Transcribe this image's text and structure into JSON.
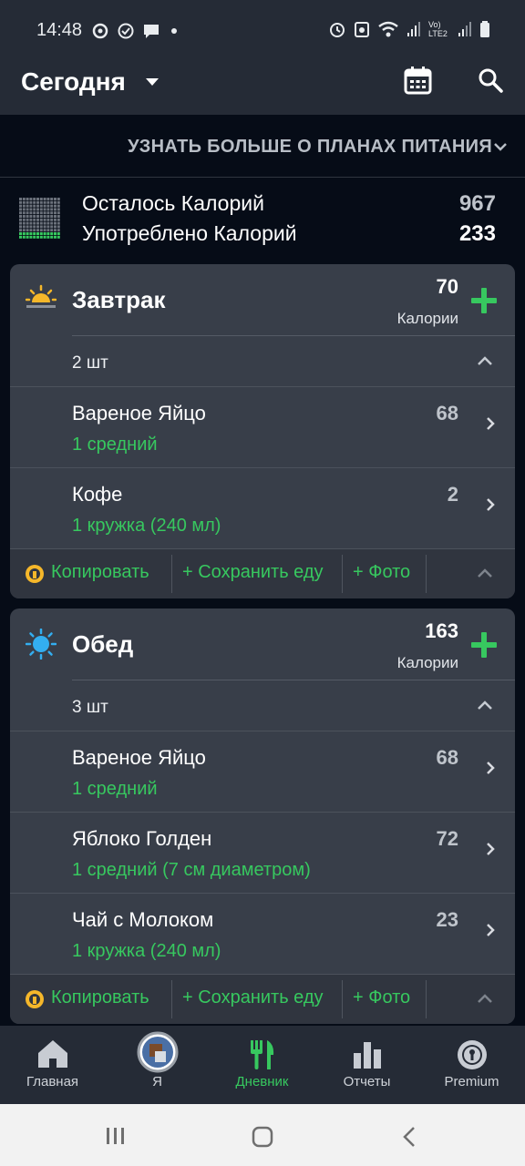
{
  "status_bar": {
    "time": "14:48",
    "icons": [
      "sync-icon",
      "check-circle-icon",
      "chat-icon",
      "dot-icon",
      "alarm-icon",
      "recycle-icon",
      "wifi-icon",
      "signal-icon",
      "volte-icon",
      "battery-icon"
    ],
    "network_label": "Vo) LTE2"
  },
  "header": {
    "title": "Сегодня",
    "icons": [
      "caret-down-icon",
      "calendar-icon",
      "search-icon"
    ]
  },
  "plans_banner": {
    "label": "УЗНАТЬ БОЛЬШЕ О ПЛАНАХ ПИТАНИЯ"
  },
  "summary": {
    "remaining_label": "Осталось Калорий",
    "remaining_value": "967",
    "consumed_label": "Употреблено Калорий",
    "consumed_value": "233"
  },
  "meals": [
    {
      "name": "Завтрак",
      "icon": "sunrise-icon",
      "calories": "70",
      "calories_label": "Калории",
      "count": "2 шт",
      "items": [
        {
          "name": "Вареное Яйцо",
          "portion": "1 средний",
          "calories": "68"
        },
        {
          "name": "Кофе",
          "portion": "1 кружка (240 мл)",
          "calories": "2"
        }
      ],
      "actions": {
        "copy": "Копировать",
        "save": "+ Сохранить еду",
        "photo": "+ Фото"
      }
    },
    {
      "name": "Обед",
      "icon": "sun-icon",
      "calories": "163",
      "calories_label": "Калории",
      "count": "3 шт",
      "items": [
        {
          "name": "Вареное Яйцо",
          "portion": "1 средний",
          "calories": "68"
        },
        {
          "name": "Яблоко Голден",
          "portion": "1 средний (7 см диаметром)",
          "calories": "72"
        },
        {
          "name": "Чай с Молоком",
          "portion": "1 кружка (240 мл)",
          "calories": "23"
        }
      ],
      "actions": {
        "copy": "Копировать",
        "save": "+ Сохранить еду",
        "photo": "+ Фото"
      }
    }
  ],
  "bottom_nav": [
    {
      "label": "Главная",
      "icon": "home-icon"
    },
    {
      "label": "Я",
      "icon": "avatar-icon"
    },
    {
      "label": "Дневник",
      "icon": "fork-knife-icon",
      "active": true
    },
    {
      "label": "Отчеты",
      "icon": "bar-chart-icon"
    },
    {
      "label": "Premium",
      "icon": "premium-badge-icon"
    }
  ],
  "colors": {
    "accent": "#37c85f",
    "background": "#060c17",
    "card": "#383e49",
    "appbar": "#252b36"
  }
}
